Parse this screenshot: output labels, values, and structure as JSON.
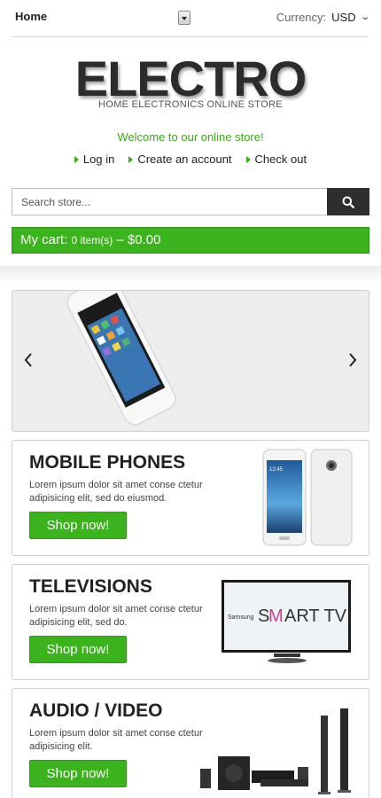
{
  "topbar": {
    "home_label": "Home",
    "currency_label": "Currency:",
    "currency_value": "USD"
  },
  "branding": {
    "logo": "ELECTRO",
    "tagline": "HOME ELECTRONICS ONLINE STORE"
  },
  "welcome": "Welcome to our online store!",
  "user_links": [
    {
      "label": "Log in"
    },
    {
      "label": "Create an account"
    },
    {
      "label": "Check out"
    }
  ],
  "search": {
    "placeholder": "Search store..."
  },
  "cart": {
    "label": "My cart:",
    "items": "0 item(s)",
    "separator": "–",
    "total": "$0.00"
  },
  "banners": [
    {
      "title": "MOBILE PHONES",
      "description": "Lorem ipsum dolor sit amet conse ctetur adipisicing elit, sed do eiusmod.",
      "button": "Shop now!"
    },
    {
      "title": "TELEVISIONS",
      "description": "Lorem ipsum dolor sit amet conse ctetur adipisicing elit, sed do.",
      "button": "Shop now!",
      "tv_brand": "Samsung",
      "tv_text_s": "S",
      "tv_text_m": "M",
      "tv_text_art": "ART TV"
    },
    {
      "title": "AUDIO / VIDEO",
      "description": "Lorem ipsum dolor sit amet conse ctetur adipisicing elit.",
      "button": "Shop now!"
    }
  ],
  "phone_screen_time": "12:45",
  "colors": {
    "accent_green": "#3bb31d",
    "welcome_green": "#3bab17",
    "dark_button": "#2e2e2e"
  },
  "icons": [
    "select-arrow-icon",
    "chevron-down-icon",
    "link-arrow-icon",
    "search-icon",
    "slider-prev-icon",
    "slider-next-icon"
  ]
}
